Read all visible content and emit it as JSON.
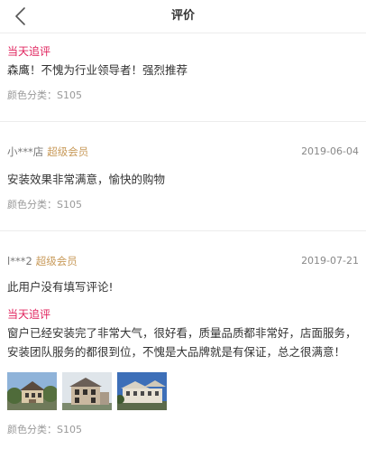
{
  "header": {
    "title": "评价"
  },
  "reviews": [
    {
      "followup_label": "当天追评",
      "followup_text": "森鹰！不愧为行业领导者！强烈推荐",
      "spec": "颜色分类：S105"
    },
    {
      "user": "小***店",
      "badge": "超级会员",
      "date": "2019-06-04",
      "text": "安装效果非常满意，愉快的购物",
      "spec": "颜色分类：S105"
    },
    {
      "user": "l***2",
      "badge": "超级会员",
      "date": "2019-07-21",
      "text": "此用户没有填写评论!",
      "followup_label": "当天追评",
      "followup_text": "窗户已经安装完了非常大气，很好看，质量品质都非常好，店面服务，安装团队服务的都很到位，不愧是大品牌就是有保证，总之很满意！",
      "spec": "颜色分类：S105"
    }
  ],
  "colors": {
    "followup": "#e0245e",
    "badge": "#c89a5a",
    "divider": "#ececec"
  },
  "icons": {
    "back": "chevron-left-icon"
  }
}
